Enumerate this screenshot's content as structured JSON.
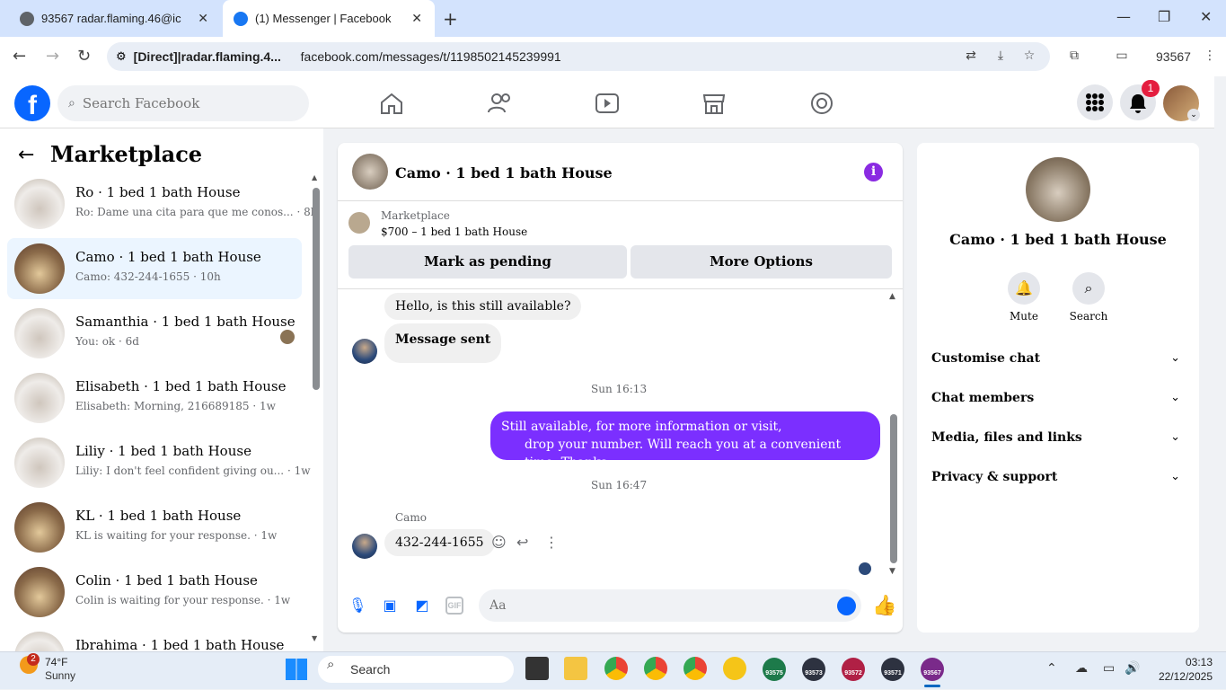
{
  "browser": {
    "tabs": [
      {
        "title": "93567 radar.flaming.46@ic"
      },
      {
        "title": "(1) Messenger | Facebook"
      }
    ],
    "site_label": "[Direct]|radar.flaming.4...",
    "url": "facebook.com/messages/t/1198502145239991",
    "profile_label": "93567"
  },
  "fb": {
    "search_placeholder": "Search Facebook",
    "notification_count": "1"
  },
  "left": {
    "title": "Marketplace",
    "conversations": [
      {
        "name": "Ro · 1 bed 1 bath House",
        "preview": "Ro: Dame una cita para que me conos... · 8h"
      },
      {
        "name": "Camo · 1 bed 1 bath House",
        "preview": "Camo: 432-244-1655 · 10h"
      },
      {
        "name": "Samanthia · 1 bed 1 bath House",
        "preview": "You: ok · 6d"
      },
      {
        "name": "Elisabeth · 1 bed 1 bath House",
        "preview": "Elisabeth: Morning, 216689185 · 1w"
      },
      {
        "name": "Liliy · 1 bed 1 bath House",
        "preview": "Liliy: I don't feel confident giving ou... · 1w"
      },
      {
        "name": "KL · 1 bed 1 bath House",
        "preview": "KL is waiting for your response. · 1w"
      },
      {
        "name": "Colin · 1 bed 1 bath House",
        "preview": "Colin is waiting for your response. · 1w"
      },
      {
        "name": "Ibrahima · 1 bed 1 bath House",
        "preview": ""
      }
    ]
  },
  "chat": {
    "title": "Camo · 1 bed 1 bath House",
    "marketplace_label": "Marketplace",
    "listing": "$700 – 1 bed 1 bath House",
    "mark_pending": "Mark as pending",
    "more_options": "More Options",
    "msg_in_1": "Hello, is this still available?",
    "msg_in_2": "Message sent",
    "stamp_1": "Sun 16:13",
    "msg_out_line1": "Still available, for more information or visit,",
    "msg_out_line2": "drop your number. Will reach you at a convenient time. Thanks.",
    "stamp_2": "Sun 16:47",
    "sender": "Camo",
    "msg_in_3": "432-244-1655",
    "input_placeholder": "Aa"
  },
  "right": {
    "title": "Camo · 1 bed 1 bath House",
    "mute": "Mute",
    "search": "Search",
    "sections": [
      "Customise chat",
      "Chat members",
      "Media, files and links",
      "Privacy & support"
    ]
  },
  "taskbar": {
    "temp": "74°F",
    "condition": "Sunny",
    "weather_badge": "2",
    "search": "Search",
    "apps": [
      "93575",
      "93573",
      "93572",
      "93571",
      "93567"
    ],
    "time": "03:13",
    "date": "22/12/2025"
  }
}
